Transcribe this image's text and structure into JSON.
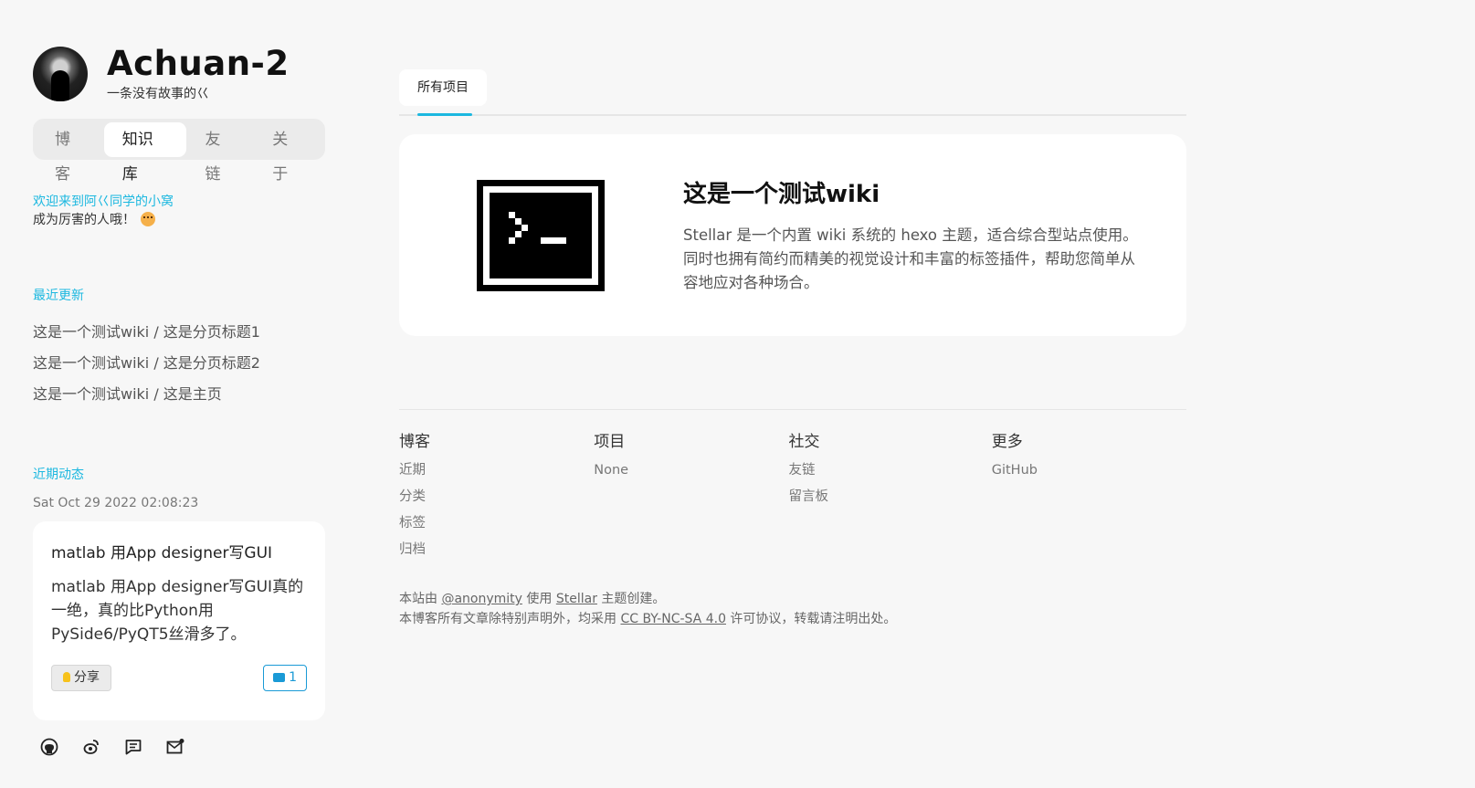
{
  "sidebar": {
    "site_title": "Achuan-2",
    "site_subtitle": "一条没有故事的巜",
    "nav": [
      {
        "label": "博客"
      },
      {
        "label": "知识库"
      },
      {
        "label": "友链"
      },
      {
        "label": "关于"
      }
    ],
    "welcome": {
      "line1": "欢迎来到阿巜同学的小窝",
      "line2": "成为厉害的人哦！"
    },
    "recent": {
      "heading": "最近更新",
      "items": [
        "这是一个测试wiki / 这是分页标题1",
        "这是一个测试wiki / 这是分页标题2",
        "这是一个测试wiki / 这是主页"
      ]
    },
    "activity": {
      "heading": "近期动态",
      "time": "Sat Oct 29 2022 02:08:23",
      "card": {
        "title": "matlab 用App designer写GUI",
        "body": "matlab 用App designer写GUI真的一绝，真的比Python用PySide6/PyQT5丝滑多了。",
        "share_label": "分享",
        "comment_count": "1"
      }
    },
    "social_icons": [
      "github-icon",
      "weibo-icon",
      "message-icon",
      "mail-icon"
    ]
  },
  "main": {
    "tabs": [
      {
        "label": "所有项目"
      }
    ],
    "wiki": {
      "title": "这是一个测试wiki",
      "description": "Stellar 是一个内置 wiki 系统的 hexo 主题，适合综合型站点使用。同时也拥有简约而精美的视觉设计和丰富的标签插件，帮助您简单从容地应对各种场合。"
    },
    "footer": {
      "columns": [
        {
          "heading": "博客",
          "links": [
            "近期",
            "分类",
            "标签",
            "归档"
          ]
        },
        {
          "heading": "项目",
          "links": [
            "None"
          ]
        },
        {
          "heading": "社交",
          "links": [
            "友链",
            "留言板"
          ]
        },
        {
          "heading": "更多",
          "links": [
            "GitHub"
          ]
        }
      ],
      "note1": {
        "prefix": "本站由 ",
        "user": "@anonymity",
        "mid": " 使用 ",
        "theme": "Stellar",
        "suffix": " 主题创建。"
      },
      "note2": {
        "prefix": "本博客所有文章除特别声明外，均采用 ",
        "license": "CC BY-NC-SA 4.0",
        "suffix": " 许可协议，转载请注明出处。"
      }
    }
  },
  "colors": {
    "accent": "#1cb8e0",
    "background": "#f7f7f7",
    "card": "#ffffff",
    "comment_blue": "#1a9ad6"
  }
}
